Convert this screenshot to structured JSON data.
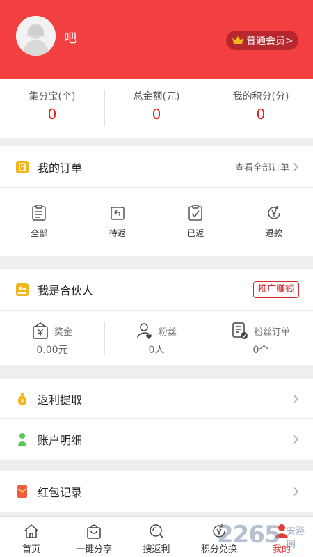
{
  "header": {
    "username": "吧",
    "member_badge": "普通会员>"
  },
  "stats": [
    {
      "label": "集分宝(个)",
      "value": "0"
    },
    {
      "label": "总金额(元)",
      "value": "0"
    },
    {
      "label": "我的积分(分)",
      "value": "0"
    }
  ],
  "orders": {
    "title": "我的订单",
    "link": "查看全部订单",
    "items": [
      {
        "label": "全部",
        "icon": "clipboard-list-icon"
      },
      {
        "label": "待返",
        "icon": "return-box-icon"
      },
      {
        "label": "已返",
        "icon": "clipboard-check-icon"
      },
      {
        "label": "退款",
        "icon": "yen-refund-icon"
      }
    ]
  },
  "partner": {
    "title": "我是合伙人",
    "promote": "推广赚钱",
    "items": [
      {
        "label": "奖金",
        "value": "0.00元",
        "icon": "yen-bag-icon"
      },
      {
        "label": "粉丝",
        "value": "0人",
        "icon": "user-heart-icon"
      },
      {
        "label": "粉丝订单",
        "value": "0个",
        "icon": "order-check-icon"
      }
    ]
  },
  "menu": [
    {
      "label": "返利提取",
      "icon": "money-bag-icon"
    },
    {
      "label": "账户明细",
      "icon": "person-icon"
    }
  ],
  "menu2": [
    {
      "label": "红包记录",
      "icon": "red-envelope-icon"
    }
  ],
  "tabbar": [
    {
      "label": "首页",
      "icon": "home-icon"
    },
    {
      "label": "一键分享",
      "icon": "shopping-bag-icon"
    },
    {
      "label": "搜返利",
      "icon": "search-icon"
    },
    {
      "label": "积分兑换",
      "icon": "points-exchange-icon"
    },
    {
      "label": "我的",
      "icon": "profile-icon",
      "active": true
    }
  ],
  "watermark": {
    "number": "2265",
    "text": "安游网"
  },
  "colors": {
    "brand_red": "#f33f3f",
    "value_red": "#e0201f",
    "badge_bg": "#b7282e",
    "gold": "#f3b51b"
  }
}
